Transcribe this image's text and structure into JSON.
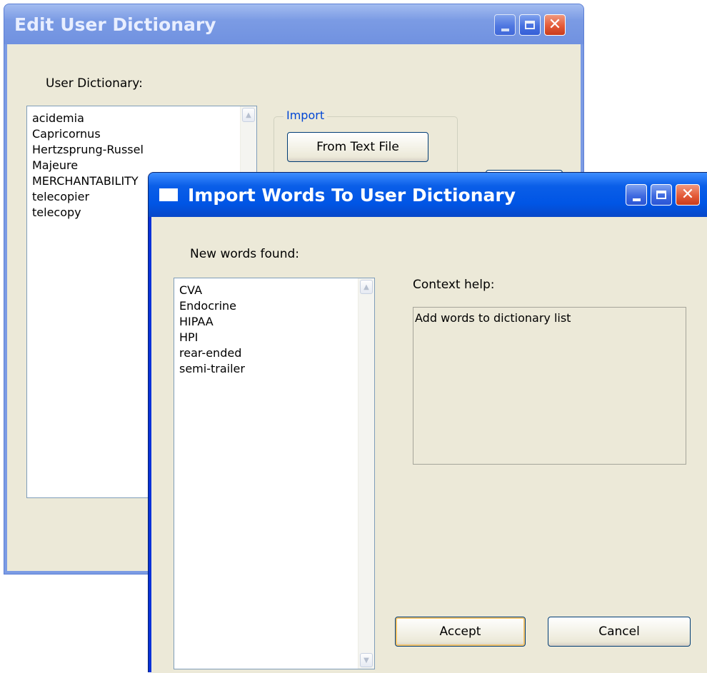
{
  "edit_dialog": {
    "title": "Edit User Dictionary",
    "list_label": "User Dictionary:",
    "words": [
      "acidemia",
      "Capricornus",
      "Hertzsprung-Russel",
      "Majeure",
      "MERCHANTABILITY",
      "telecopier",
      "telecopy"
    ],
    "import_group_label": "Import",
    "from_text_file_label": "From Text File"
  },
  "import_dialog": {
    "title": "Import Words To User Dictionary",
    "new_words_label": "New words found:",
    "words": [
      "CVA",
      "Endocrine",
      "HIPAA",
      "HPI",
      "rear-ended",
      "semi-trailer"
    ],
    "context_help_label": "Context help:",
    "context_help_text": "Add words to dictionary list",
    "accept_label": "Accept",
    "cancel_label": "Cancel"
  },
  "icons": {
    "minimize": "minimize-icon",
    "maximize": "maximize-icon",
    "close": "close-icon",
    "window": "window-icon",
    "scroll_up": "scroll-up-arrow-icon",
    "scroll_down": "scroll-down-arrow-icon"
  },
  "colors": {
    "title_bar": "#0a5ee8",
    "title_bar_inactive": "#7b9be4",
    "client_bg": "#ece9d8",
    "group_label": "#0046d5"
  }
}
